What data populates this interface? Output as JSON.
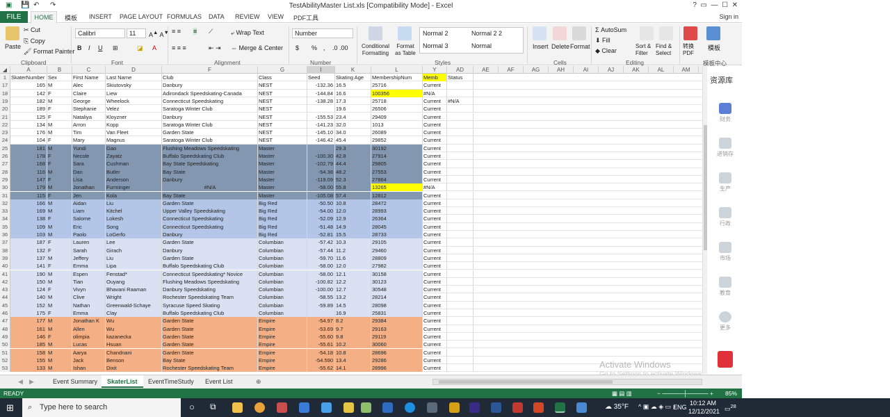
{
  "window": {
    "title": "TestAbilityMaster List.xls  [Compatibility Mode] - Excel",
    "signin": "Sign in"
  },
  "ribbon_tabs": [
    "FILE",
    "HOME",
    "模板",
    "INSERT",
    "PAGE LAYOUT",
    "FORMULAS",
    "DATA",
    "REVIEW",
    "VIEW",
    "PDF工具"
  ],
  "ribbon": {
    "clipboard": {
      "paste": "Paste",
      "cut": "Cut",
      "copy": "Copy",
      "format_painter": "Format Painter",
      "label": "Clipboard"
    },
    "font": {
      "name": "Calibri",
      "size": "11",
      "label": "Font",
      "bold": "B",
      "italic": "I",
      "underline": "U"
    },
    "alignment": {
      "wrap": "Wrap Text",
      "merge": "Merge & Center",
      "label": "Alignment"
    },
    "number": {
      "format": "Number",
      "currency": "$",
      "percent": "%",
      "comma": ",",
      "label": "Number"
    },
    "styles": {
      "cond_format": "Conditional Formatting",
      "format_table": "Format as Table",
      "normal2": "Normal 2",
      "normal22": "Normal 2 2",
      "normal3": "Normal 3",
      "normal": "Normal",
      "label": "Styles"
    },
    "cells": {
      "insert": "Insert",
      "delete": "Delete",
      "format": "Format",
      "label": "Cells"
    },
    "editing": {
      "autosum": "AutoSum",
      "fill": "Fill",
      "clear": "Clear",
      "sort": "Sort & Filter",
      "find": "Find & Select",
      "label": "Editing"
    },
    "pdf": {
      "convert": "转换 PDF",
      "template": "模板"
    },
    "help": "模板中心"
  },
  "columns": [
    "A",
    "B",
    "C",
    "D",
    "F",
    "G",
    "I",
    "K",
    "L",
    "Y",
    "AD",
    "AE",
    "AF",
    "AG",
    "AH",
    "AI",
    "AJ",
    "AK",
    "AL",
    "AM"
  ],
  "header_row": {
    "num": "1",
    "cells": [
      "SkaterNumber",
      "Sex",
      "First Name",
      "Last Name",
      "Club",
      "Class",
      "Seed",
      "Skating Age",
      "MembershipNum",
      "Memb",
      "Status"
    ]
  },
  "rows": [
    {
      "n": "17",
      "num": "165",
      "sex": "M",
      "first": "Alec",
      "last": "Skiutovsky",
      "club": "Danbury",
      "cls": "NEST",
      "seed": "-132.36",
      "age": "16.5",
      "memnum": "25716",
      "memb": "Current",
      "extra": "",
      "grp": "nest"
    },
    {
      "n": "18",
      "num": "142",
      "sex": "F",
      "first": "Claire",
      "last": "Liew",
      "club": "Adirondack Speedskating-Canada",
      "cls": "NEST",
      "seed": "-144.84",
      "age": "16.6",
      "memnum": "100356",
      "memb": "#N/A",
      "extra": "",
      "grp": "nest",
      "hl": true
    },
    {
      "n": "19",
      "num": "182",
      "sex": "M",
      "first": "George",
      "last": "Wheelock",
      "club": "Connecticut Speedskating",
      "cls": "NEST",
      "seed": "-138.28",
      "age": "17.3",
      "memnum": "25718",
      "memb": "Current",
      "extra": "#N/A",
      "grp": "nest"
    },
    {
      "n": "20",
      "num": "189",
      "sex": "F",
      "first": "Stephanie",
      "last": "Velez",
      "club": "Saratoga Winter Club",
      "cls": "NEST",
      "seed": "",
      "age": "19.6",
      "memnum": "26506",
      "memb": "Current",
      "extra": "",
      "grp": "nest"
    },
    {
      "n": "21",
      "num": "125",
      "sex": "F",
      "first": "Nataliya",
      "last": "Kloyzner",
      "club": "Danbury",
      "cls": "NEST",
      "seed": "-155.53",
      "age": "23.4",
      "memnum": "29409",
      "memb": "Current",
      "extra": "",
      "grp": "nest"
    },
    {
      "n": "22",
      "num": "134",
      "sex": "M",
      "first": "Arron",
      "last": "Kopp",
      "club": "Saratoga Winter Club",
      "cls": "NEST",
      "seed": "-141.23",
      "age": "32.0",
      "memnum": "1013",
      "memb": "Current",
      "extra": "",
      "grp": "nest"
    },
    {
      "n": "23",
      "num": "176",
      "sex": "M",
      "first": "Tim",
      "last": "Van Fleet",
      "club": "Garden State",
      "cls": "NEST",
      "seed": "-145.10",
      "age": "34.0",
      "memnum": "26089",
      "memb": "Current",
      "extra": "",
      "grp": "nest"
    },
    {
      "n": "24",
      "num": "104",
      "sex": "F",
      "first": "Mary",
      "last": "Magnus",
      "club": "Saratoga Winter Club",
      "cls": "NEST",
      "seed": "-146.42",
      "age": "45.4",
      "memnum": "29852",
      "memb": "Current",
      "extra": "",
      "grp": "nest"
    },
    {
      "n": "25",
      "num": "181",
      "sex": "M",
      "first": "Yundi",
      "last": "Gao",
      "club": "Flushing Meadows Speedskating",
      "cls": "Master",
      "seed": "",
      "age": "29.3",
      "memnum": "30192",
      "memb": "Current",
      "extra": "",
      "grp": "master"
    },
    {
      "n": "26",
      "num": "178",
      "sex": "F",
      "first": "Necole",
      "last": "Zayatz",
      "club": "Buffalo Speedskating Club",
      "cls": "Master",
      "seed": "-100.30",
      "age": "42.8",
      "memnum": "27914",
      "memb": "Current",
      "extra": "",
      "grp": "master"
    },
    {
      "n": "27",
      "num": "168",
      "sex": "F",
      "first": "Sara",
      "last": "Cushman",
      "club": "Bay State Speedskating",
      "cls": "Master",
      "seed": "-102.79",
      "age": "44.4",
      "memnum": "29805",
      "memb": "Current",
      "extra": "",
      "grp": "master"
    },
    {
      "n": "28",
      "num": "116",
      "sex": "M",
      "first": "Dan",
      "last": "Butler",
      "club": "Bay State",
      "cls": "Master",
      "seed": "-54.38",
      "age": "48.2",
      "memnum": "27553",
      "memb": "Current",
      "extra": "",
      "grp": "master"
    },
    {
      "n": "29",
      "num": "147",
      "sex": "F",
      "first": "Lisa",
      "last": "Anderson",
      "club": "Danbury",
      "cls": "Master",
      "seed": "-119.09",
      "age": "52.3",
      "memnum": "27864",
      "memb": "Current",
      "extra": "",
      "grp": "master"
    },
    {
      "n": "30",
      "num": "179",
      "sex": "M",
      "first": "Jonathan",
      "last": "Furminger",
      "club": "#N/A",
      "cls": "Master",
      "seed": "-58.00",
      "age": "55.8",
      "memnum": "13265",
      "memb": "#N/A",
      "extra": "",
      "grp": "master",
      "hl": true
    },
    {
      "n": "31",
      "num": "115",
      "sex": "F",
      "first": "Jen",
      "last": "Kola",
      "club": "Bay State",
      "cls": "Master",
      "seed": "-105.08",
      "age": "57.4",
      "memnum": "12812",
      "memb": "Current",
      "extra": "",
      "grp": "master"
    },
    {
      "n": "32",
      "num": "166",
      "sex": "M",
      "first": "Aidan",
      "last": "Liu",
      "club": "Garden State",
      "cls": "Big Red",
      "seed": "-50.50",
      "age": "10.8",
      "memnum": "28472",
      "memb": "Current",
      "extra": "",
      "grp": "bigred"
    },
    {
      "n": "33",
      "num": "169",
      "sex": "M",
      "first": "Liam",
      "last": "Kitchel",
      "club": "Upper Valley Speedskating",
      "cls": "Big Red",
      "seed": "-54.00",
      "age": "12.0",
      "memnum": "28993",
      "memb": "Current",
      "extra": "",
      "grp": "bigred"
    },
    {
      "n": "34",
      "num": "138",
      "sex": "F",
      "first": "Salome",
      "last": "Lokesh",
      "club": "Connecticut Speedskating",
      "cls": "Big Red",
      "seed": "-52.09",
      "age": "12.9",
      "memnum": "26364",
      "memb": "Current",
      "extra": "",
      "grp": "bigred"
    },
    {
      "n": "35",
      "num": "109",
      "sex": "M",
      "first": "Eric",
      "last": "Song",
      "club": "Connecticut Speedskating",
      "cls": "Big Red",
      "seed": "-51.48",
      "age": "14.9",
      "memnum": "28045",
      "memb": "Current",
      "extra": "",
      "grp": "bigred"
    },
    {
      "n": "36",
      "num": "103",
      "sex": "M",
      "first": "Paolo",
      "last": "LoGerfo",
      "club": "Danbury",
      "cls": "Big Red",
      "seed": "-52.81",
      "age": "15.5",
      "memnum": "28733",
      "memb": "Current",
      "extra": "",
      "grp": "bigred"
    },
    {
      "n": "37",
      "num": "187",
      "sex": "F",
      "first": "Lauren",
      "last": "Lee",
      "club": "Garden State",
      "cls": "Columbian",
      "seed": "-57.42",
      "age": "10.3",
      "memnum": "29105",
      "memb": "Current",
      "extra": "",
      "grp": "col"
    },
    {
      "n": "38",
      "num": "132",
      "sex": "F",
      "first": "Sarah",
      "last": "Girach",
      "club": "Danbury",
      "cls": "Columbian",
      "seed": "-57.44",
      "age": "11.2",
      "memnum": "29460",
      "memb": "Current",
      "extra": "",
      "grp": "col"
    },
    {
      "n": "39",
      "num": "137",
      "sex": "M",
      "first": "Jeffery",
      "last": "Liu",
      "club": "Garden State",
      "cls": "Columbian",
      "seed": "-59.70",
      "age": "11.6",
      "memnum": "28809",
      "memb": "Current",
      "extra": "",
      "grp": "col"
    },
    {
      "n": "40",
      "num": "141",
      "sex": "F",
      "first": "Emma",
      "last": "Lipa",
      "club": "Buffalo Speedskating Club",
      "cls": "Columbian",
      "seed": "-58.00",
      "age": "12.0",
      "memnum": "27982",
      "memb": "Current",
      "extra": "",
      "grp": "col"
    },
    {
      "n": "41",
      "num": "190",
      "sex": "M",
      "first": "Espen",
      "last": "Fenstad*",
      "club": "Connecticut Speedskating* Novice",
      "cls": "Columbian",
      "seed": "-58.00",
      "age": "12.1",
      "memnum": "30158",
      "memb": "Current",
      "extra": "",
      "grp": "col"
    },
    {
      "n": "42",
      "num": "150",
      "sex": "M",
      "first": "Tian",
      "last": "Ouyang",
      "club": "Flushing Meadows Speedskating",
      "cls": "Columbian",
      "seed": "-100.82",
      "age": "12.2",
      "memnum": "30123",
      "memb": "Current",
      "extra": "",
      "grp": "col"
    },
    {
      "n": "43",
      "num": "124",
      "sex": "F",
      "first": "Vivyn",
      "last": "Bhavani Raaman",
      "club": "Danbury Speedskating",
      "cls": "Columbian",
      "seed": "-100.00",
      "age": "12.7",
      "memnum": "30548",
      "memb": "Current",
      "extra": "",
      "grp": "col"
    },
    {
      "n": "44",
      "num": "140",
      "sex": "M",
      "first": "Clive",
      "last": "Wright",
      "club": "Rochester Speedskating Team",
      "cls": "Columbian",
      "seed": "-58.55",
      "age": "13.2",
      "memnum": "28214",
      "memb": "Current",
      "extra": "",
      "grp": "col"
    },
    {
      "n": "45",
      "num": "152",
      "sex": "M",
      "first": "Nathan",
      "last": "Greenwald-Schaye",
      "club": "Syracuse Speed Skating",
      "cls": "Columbian",
      "seed": "-59.89",
      "age": "14.5",
      "memnum": "28098",
      "memb": "Current",
      "extra": "",
      "grp": "col"
    },
    {
      "n": "46",
      "num": "175",
      "sex": "F",
      "first": "Emma",
      "last": "Clay",
      "club": "Buffalo Speedskating Club",
      "cls": "Columbian",
      "seed": "",
      "age": "16.9",
      "memnum": "25831",
      "memb": "Current",
      "extra": "",
      "grp": "col"
    },
    {
      "n": "47",
      "num": "177",
      "sex": "M",
      "first": "Jonathan K",
      "last": "Wu",
      "club": "Garden State",
      "cls": "Empire",
      "seed": "-54.97",
      "age": "8.2",
      "memnum": "29384",
      "memb": "Current",
      "extra": "",
      "grp": "emp"
    },
    {
      "n": "48",
      "num": "161",
      "sex": "M",
      "first": "Allen",
      "last": "Wu",
      "club": "Garden State",
      "cls": "Empire",
      "seed": "-53.69",
      "age": "9.7",
      "memnum": "29163",
      "memb": "Current",
      "extra": "",
      "grp": "emp"
    },
    {
      "n": "49",
      "num": "146",
      "sex": "F",
      "first": "olimpia",
      "last": "kazanecka",
      "club": "Garden State",
      "cls": "Empire",
      "seed": "-55.60",
      "age": "9.8",
      "memnum": "29119",
      "memb": "Current",
      "extra": "",
      "grp": "emp"
    },
    {
      "n": "50",
      "num": "185",
      "sex": "M",
      "first": "Lucas",
      "last": "Hsuan",
      "club": "Garden State",
      "cls": "Empire",
      "seed": "-55.61",
      "age": "10.2",
      "memnum": "30060",
      "memb": "Current",
      "extra": "",
      "grp": "emp"
    },
    {
      "n": "51",
      "num": "158",
      "sex": "M",
      "first": "Aarya",
      "last": "Chandnani",
      "club": "Garden State",
      "cls": "Empire",
      "seed": "-54.18",
      "age": "10.8",
      "memnum": "28696",
      "memb": "Current",
      "extra": "",
      "grp": "emp"
    },
    {
      "n": "52",
      "num": "155",
      "sex": "M",
      "first": "Jack",
      "last": "Benson",
      "club": "Bay State",
      "cls": "Empire",
      "seed": "-54.590",
      "age": "13.4",
      "memnum": "29286",
      "memb": "Current",
      "extra": "",
      "grp": "emp"
    },
    {
      "n": "53",
      "num": "133",
      "sex": "M",
      "first": "Ishan",
      "last": "Dixit",
      "club": "Rochester Speedskating Team",
      "cls": "Empire",
      "seed": "-55.62",
      "age": "14.1",
      "memnum": "28996",
      "memb": "Current",
      "extra": "",
      "grp": "emp"
    }
  ],
  "sheets": [
    "Event Summary",
    "SkaterList",
    "EventTimeStudy",
    "Event List"
  ],
  "status": {
    "ready": "READY",
    "zoom": "85%"
  },
  "side_panel": {
    "title": "资源库",
    "items": [
      "财务",
      "进销存",
      "生产",
      "行政",
      "市场",
      "教育",
      "更多"
    ]
  },
  "activate": {
    "line1": "Activate Windows",
    "line2": "Go to Settings to activate Windows."
  },
  "taskbar": {
    "search": "Type here to search",
    "weather": "35°F",
    "lang": "ENG",
    "time": "10:12 AM",
    "date": "12/12/2021",
    "notif": "28"
  },
  "colors": {
    "excel_green": "#217346",
    "master": "#8497b0",
    "bigred": "#b4c6e7",
    "col": "#d9e1f2",
    "emp": "#f4b084",
    "yellow": "#ffff00"
  }
}
